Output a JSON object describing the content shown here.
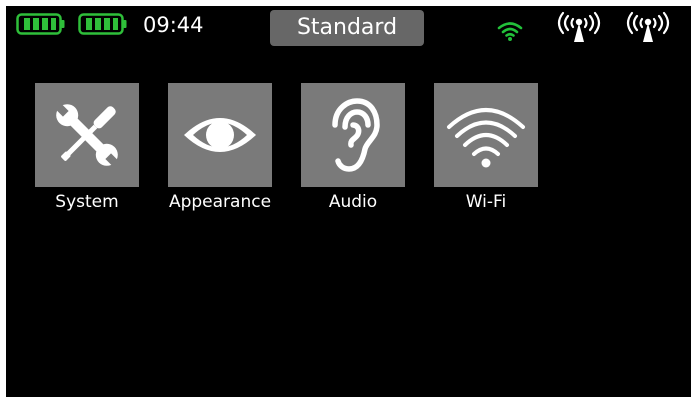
{
  "status_bar": {
    "clock": "09:44",
    "mode": "Standard",
    "batteries": [
      {
        "icon": "battery-icon",
        "level": 1.0,
        "color": "#2fbf3a"
      },
      {
        "icon": "battery-icon",
        "level": 1.0,
        "color": "#2fbf3a"
      }
    ],
    "wifi": {
      "icon": "wifi-status-icon",
      "color": "#22c03a"
    },
    "antennas": [
      {
        "icon": "antenna-signal-icon"
      },
      {
        "icon": "antenna-signal-icon"
      }
    ]
  },
  "menu": {
    "items": [
      {
        "label": "System",
        "icon": "wrench-screwdriver-icon"
      },
      {
        "label": "Appearance",
        "icon": "eye-icon"
      },
      {
        "label": "Audio",
        "icon": "ear-icon"
      },
      {
        "label": "Wi-Fi",
        "icon": "wifi-icon"
      }
    ]
  },
  "colors": {
    "background": "#000000",
    "tile": "#7a7a7a",
    "mode_pill": "#676767",
    "text": "#ffffff",
    "accent_green": "#2fbf3a"
  }
}
